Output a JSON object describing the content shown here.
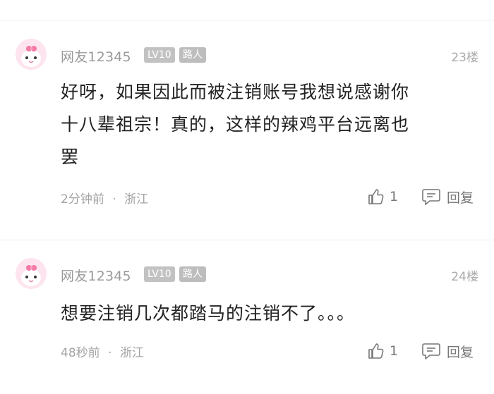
{
  "comments": [
    {
      "username": "网友12345",
      "level": "LV10",
      "role": "路人",
      "floor": "23楼",
      "lines": [
        "好呀，如果因此而被注销账号我想说感谢你",
        "十八辈祖宗！真的，这样的辣鸡平台远离也",
        "罢"
      ],
      "time": "2分钟前",
      "location": "浙江",
      "likes": "1",
      "reply_label": "回复"
    },
    {
      "username": "网友12345",
      "level": "LV10",
      "role": "路人",
      "floor": "24楼",
      "lines": [
        "想要注销几次都踏马的注销不了。。。"
      ],
      "time": "48秒前",
      "location": "浙江",
      "likes": "1",
      "reply_label": "回复"
    }
  ],
  "meta_separator": "·",
  "colors": {
    "avatar_bg": "#fde4ef",
    "badge_bg": "#c2c2c2",
    "secondary_text": "#9a9a9a"
  }
}
